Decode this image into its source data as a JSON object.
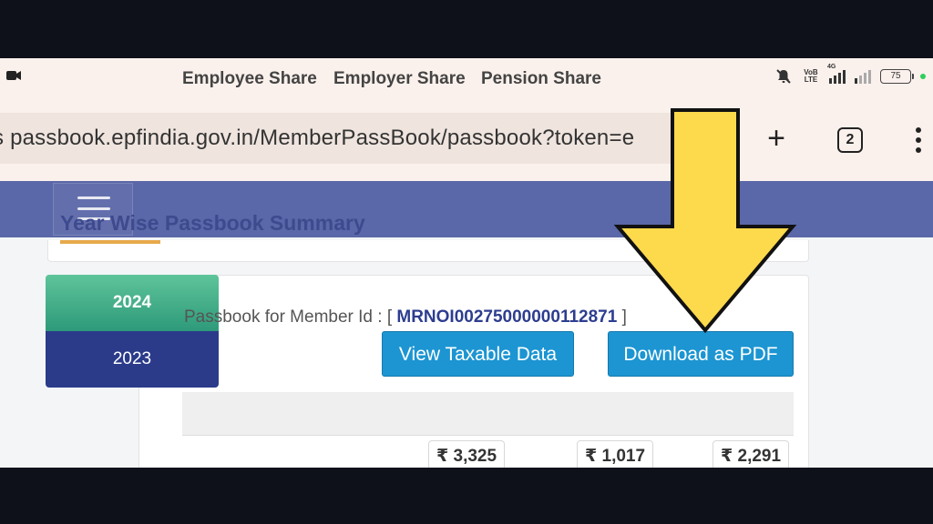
{
  "status_bar": {
    "volte_label": "VoB LTE",
    "network_label": "4G",
    "battery_level": "75"
  },
  "browser": {
    "url": "s passbook.epfindia.gov.in/MemberPassBook/passbook?token=e",
    "tab_count": "2"
  },
  "page": {
    "summary_title": "Year Wise Passbook Summary",
    "years": [
      {
        "label": "2024",
        "active": true
      },
      {
        "label": "2023",
        "active": false
      }
    ],
    "member_prefix": "Passbook for Member Id : [",
    "member_id": "MRNOI00275000000112871",
    "member_suffix": "]",
    "buttons": {
      "view_taxable": "View Taxable Data",
      "download_pdf": "Download as PDF"
    },
    "table": {
      "headers": [
        "Employee Share",
        "Employer Share",
        "Pension Share"
      ],
      "amounts": [
        "₹ 3,325",
        "₹ 1,017",
        "₹ 2,291"
      ]
    }
  },
  "colors": {
    "header_bar": "#5a67a8",
    "button": "#1c95d2",
    "active_year": "#3aa884",
    "inactive_year": "#2b3b8a",
    "arrow": "#fdd94c"
  }
}
